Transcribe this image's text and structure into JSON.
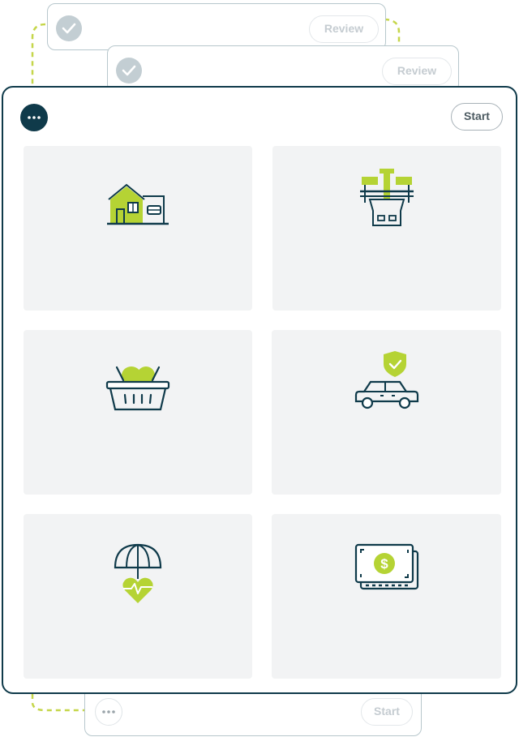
{
  "stack": {
    "back_card_1": {
      "button_label": "Review",
      "status": "completed"
    },
    "back_card_2": {
      "button_label": "Review",
      "status": "completed"
    },
    "bottom_card": {
      "button_label": "Start"
    }
  },
  "main_card": {
    "start_label": "Start",
    "tiles": [
      {
        "icon": "house-icon"
      },
      {
        "icon": "utility-pole-icon"
      },
      {
        "icon": "grocery-basket-icon"
      },
      {
        "icon": "insured-car-icon"
      },
      {
        "icon": "health-umbrella-icon"
      },
      {
        "icon": "cash-bill-icon"
      }
    ]
  },
  "colors": {
    "navy": "#0f3a4a",
    "lime": "#b5d334",
    "tile_bg": "#f2f3f4",
    "connector": "#c5d64a"
  }
}
